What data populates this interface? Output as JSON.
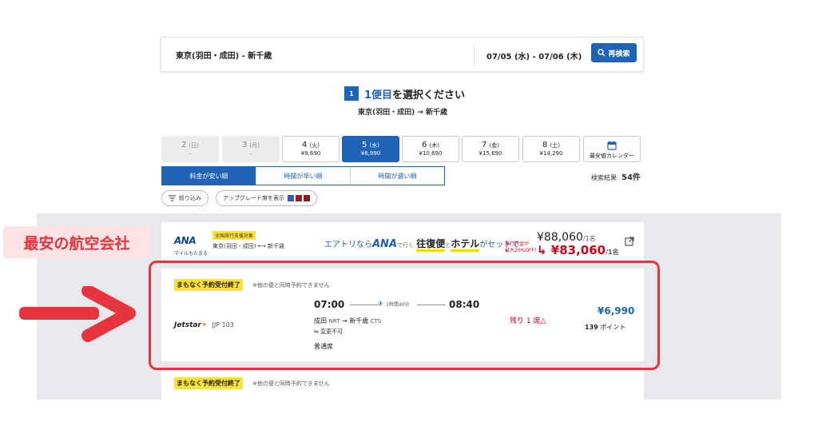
{
  "search": {
    "route": "東京(羽田・成田) - 新千歳",
    "dates": "07/05 (水) - 07/06 (木)",
    "button": "再検索"
  },
  "step": {
    "number": "1",
    "title_accent": "1便目",
    "title_rest": "を選択ください",
    "route": "東京(羽田・成田) → 新千歳"
  },
  "date_tabs": [
    {
      "day": "2",
      "weekday": "(日)",
      "price": "–"
    },
    {
      "day": "3",
      "weekday": "(月)",
      "price": "–"
    },
    {
      "day": "4",
      "weekday": "(火)",
      "price": "¥9,690"
    },
    {
      "day": "5",
      "weekday": "(水)",
      "price": "¥6,990"
    },
    {
      "day": "6",
      "weekday": "(木)",
      "price": "¥10,690"
    },
    {
      "day": "7",
      "weekday": "(金)",
      "price": "¥15,690"
    },
    {
      "day": "8",
      "weekday": "(土)",
      "price": "¥14,290"
    }
  ],
  "calendar_label": "最安値カレンダー",
  "sort": {
    "cheapest": "料金が安い順",
    "earliest": "時間が早い順",
    "latest": "時間が遅い順"
  },
  "result": {
    "label": "検索結果",
    "count": "54件"
  },
  "filter": {
    "narrow": "絞り込み",
    "upgrade": "アップグレード席を表示"
  },
  "ana": {
    "logo": "ANA",
    "mileage": "マイルもたまる",
    "tag": "全国旅行支援対象",
    "route": "東京(羽田・成田) ⟷ 新千歳",
    "promo_1": "エアトリなら",
    "promo_ana": "ANA",
    "promo_2": "で行く",
    "promo_3": "往復便",
    "promo_4": "と",
    "promo_5": "ホテル",
    "promo_6": "がセットで",
    "discount_1": "旅行代金が",
    "discount_2": "最大20%OFF!",
    "orig_price": "¥88,060",
    "sale_price": "¥83,060",
    "per_person": "/1名"
  },
  "flight": {
    "warning": "まもなく予約受付終了",
    "note": "※他の便と同時予約できません",
    "airline": "Jetstar",
    "flight_no": "JJP 103",
    "dep_time": "07:00",
    "arr_time": "08:40",
    "duration": "1時間40分",
    "dep_airport": "成田",
    "dep_code": "NRT",
    "arr_airport": "新千歳",
    "arr_code": "CTS",
    "change": "変更不可",
    "seat_class": "普通席",
    "seats_left": "残り 1 席△",
    "price": "¥6,990",
    "points": "139",
    "points_unit": "ポイント"
  },
  "flight2": {
    "warning": "まもなく予約受付終了",
    "note": "※他の便と同時予約できません"
  },
  "callout": "最安の航空会社",
  "colors": {
    "brand_blue": "#1f63b7",
    "highlight_red": "#e8343c",
    "warning_yellow": "#ffe13c"
  }
}
